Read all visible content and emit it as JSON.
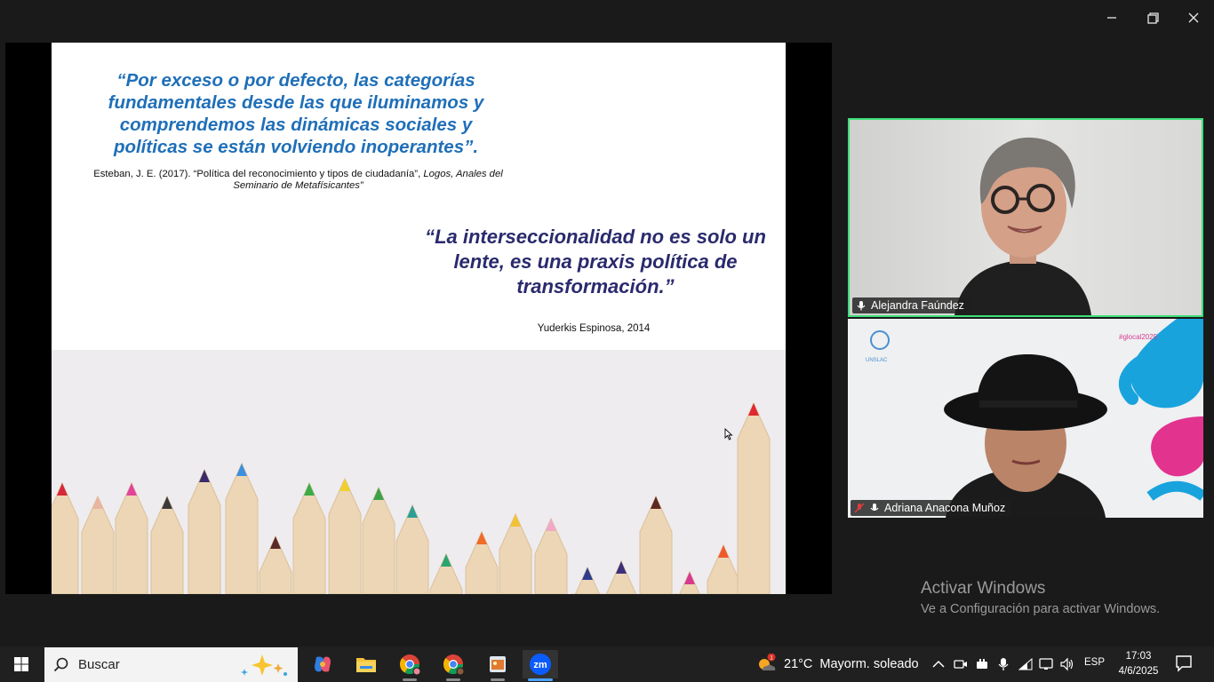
{
  "slide": {
    "quote1": "“Por exceso o por defecto, las categorías fundamentales desde las que iluminamos y comprendemos las dinámicas sociales y políticas se están volviendo inoperantes”.",
    "cite1_plain": "Esteban, J. E. (2017).  “Política del reconocimiento y tipos de ciudadanía”, ",
    "cite1_italic": "Logos, Anales del Seminario de Metafísicantes”",
    "quote2": "“La interseccionalidad no es solo un lente, es una praxis política de transformación.”",
    "cite2": "Yuderkis Espinosa, 2014"
  },
  "participants": [
    {
      "name": "Alejandra Faúndez",
      "muted": false
    },
    {
      "name": "Adriana Anacona Muñoz",
      "muted": true
    }
  ],
  "tile2_text": {
    "org": "UNSLAC",
    "tag": "#glocal2025"
  },
  "watermark": {
    "title": "Activar Windows",
    "subtitle": "Ve a Configuración para activar Windows."
  },
  "taskbar": {
    "search_placeholder": "Buscar",
    "weather": {
      "temp": "21°C",
      "condition": "Mayorm. soleado",
      "badge": "1"
    },
    "language": "ESP",
    "time": "17:03",
    "date": "4/6/2025"
  },
  "colors": {
    "quote1": "#1f6fb8",
    "quote2": "#2a2a6e",
    "active_speaker_border": "#3de07a",
    "zoom_accent": "#0b5cff"
  }
}
